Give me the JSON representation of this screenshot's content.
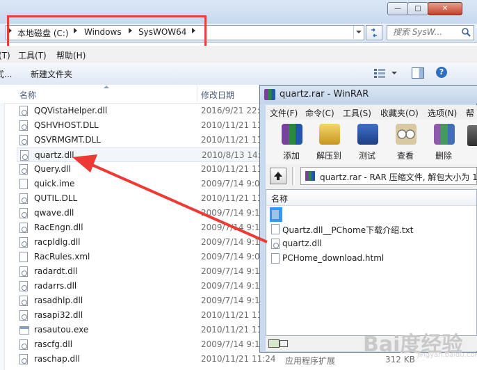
{
  "explorer": {
    "breadcrumb": [
      "本地磁盘 (C:)",
      "Windows",
      "SysWOW64"
    ],
    "search_placeholder": "搜索 SysW...",
    "menu": [
      "具(T)",
      "工具(T)",
      "帮助(H)"
    ],
    "toolbar": {
      "left_text": "式...",
      "new_folder_label": "新建文件夹"
    },
    "columns": {
      "name": "名称",
      "date": "修改日期"
    },
    "files": [
      {
        "name": "QQVistaHelper.dll",
        "date": "2016/9/21 22:0",
        "icon": "dll-icon"
      },
      {
        "name": "QSHVHOST.DLL",
        "date": "2010/11/21 11",
        "icon": "dll-icon"
      },
      {
        "name": "QSVRMGMT.DLL",
        "date": "2010/11/21 11",
        "icon": "dll-icon"
      },
      {
        "name": "quartz.dll",
        "date": "2010/8/13 14:2",
        "icon": "dll-icon"
      },
      {
        "name": "Query.dll",
        "date": "2010/11/21 11",
        "icon": "dll-icon"
      },
      {
        "name": "quick.ime",
        "date": "2009/7/14 9:06",
        "icon": "file-icon"
      },
      {
        "name": "QUTIL.DLL",
        "date": "2010/11/21 11",
        "icon": "dll-icon"
      },
      {
        "name": "qwave.dll",
        "date": "2009/7/14 9:16",
        "icon": "dll-icon"
      },
      {
        "name": "RacEngn.dll",
        "date": "2009/7/14 9:16",
        "icon": "dll-icon"
      },
      {
        "name": "racpldlg.dll",
        "date": "2009/7/14 9:16",
        "icon": "dll-icon"
      },
      {
        "name": "RacRules.xml",
        "date": "2009/7/14 9:06",
        "icon": "file-icon"
      },
      {
        "name": "radardt.dll",
        "date": "2009/7/14 9:16",
        "icon": "dll-icon"
      },
      {
        "name": "radarrs.dll",
        "date": "2009/7/14 9:16",
        "icon": "dll-icon"
      },
      {
        "name": "rasadhlp.dll",
        "date": "2009/7/14 9:16",
        "icon": "dll-icon"
      },
      {
        "name": "rasapi32.dll",
        "date": "2010/11/21 11",
        "icon": "dll-icon"
      },
      {
        "name": "rasautou.exe",
        "date": "2010/11/21 11",
        "icon": "exe-icon"
      },
      {
        "name": "rascfg.dll",
        "date": "2009/7/14 9:16",
        "icon": "dll-icon"
      },
      {
        "name": "raschap.dll",
        "date": "2010/11/21 11:24",
        "icon": "dll-icon"
      }
    ],
    "last_row": {
      "type": "应用程序扩展",
      "size": "312 KB"
    }
  },
  "rar": {
    "title": "quartz.rar - WinRAR",
    "menu": [
      "文件(F)",
      "命令(C)",
      "工具(S)",
      "收藏夹(O)",
      "选项(N)",
      "帮"
    ],
    "tools": [
      "添加",
      "解压到",
      "测试",
      "查看",
      "删除"
    ],
    "path_text": "quartz.rar - RAR 压缩文件, 解包大小为 1,",
    "column_name": "名称",
    "entries": [
      {
        "name": "..",
        "icon": "folder-up-icon"
      },
      {
        "name": "Quartz.dll__PChome下载介绍.txt",
        "icon": "text-file-icon"
      },
      {
        "name": "quartz.dll",
        "icon": "dll-icon"
      },
      {
        "name": "PCHome_download.html",
        "icon": "html-file-icon"
      }
    ]
  },
  "colors": {
    "highlight_border": "#e8413d",
    "arrow": "#ee3a34",
    "selection": "#3399ff"
  },
  "watermark": {
    "main": "Bai度经验",
    "sub": "jingyan.baidu.com"
  }
}
